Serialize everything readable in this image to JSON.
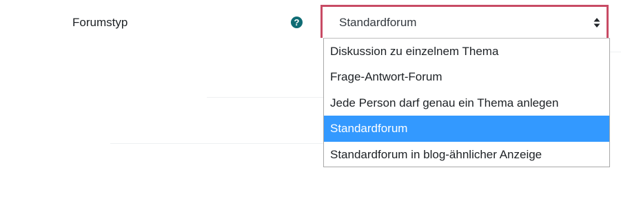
{
  "form": {
    "field_label": "Forumstyp",
    "help_icon": "question-circle-icon",
    "select": {
      "current_value": "Standardforum",
      "arrow_icon": "sort-arrows-icon",
      "highlight_color": "#c84b64",
      "options": [
        {
          "label": "Diskussion zu einzelnem Thema",
          "selected": false
        },
        {
          "label": "Frage-Antwort-Forum",
          "selected": false
        },
        {
          "label": "Jede Person darf genau ein Thema anlegen",
          "selected": false
        },
        {
          "label": "Standardforum",
          "selected": true
        },
        {
          "label": "Standardforum in blog-ähnlicher Anzeige",
          "selected": false
        }
      ]
    }
  },
  "colors": {
    "selected_option_bg": "#3399ff",
    "help_icon_bg": "#0f6c74"
  }
}
